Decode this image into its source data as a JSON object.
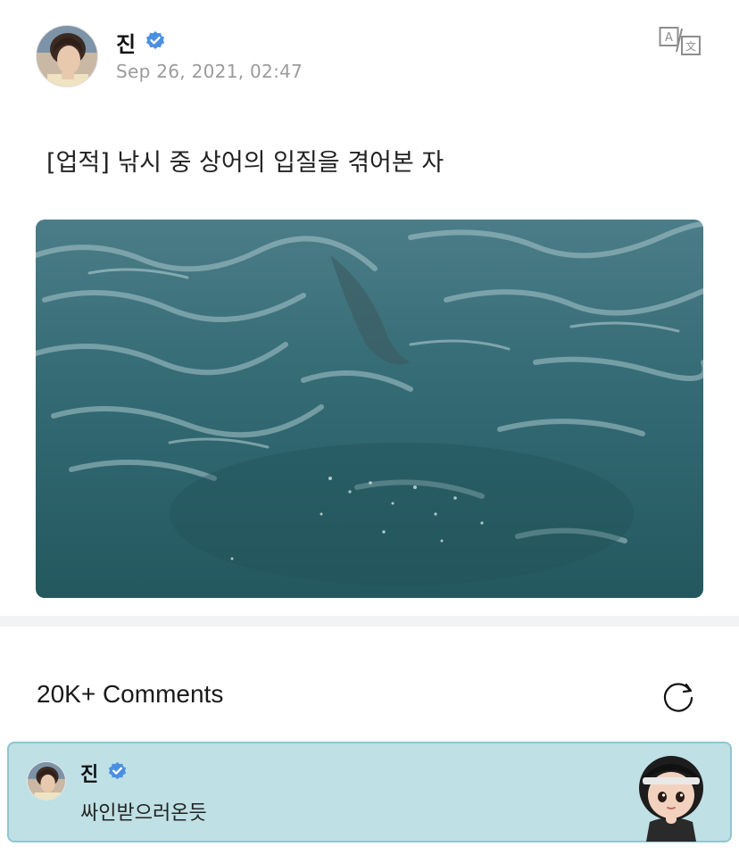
{
  "post": {
    "author": "진",
    "date": "Sep 26, 2021, 02:47",
    "text": "[업적] 낚시 중 상어의 입질을 겪어본 자",
    "translate_icon": "translate-icon"
  },
  "comments": {
    "title": "20K+ Comments",
    "refresh_icon": "refresh-icon",
    "pinned": {
      "author": "진",
      "text": "싸인받으러온듯"
    }
  },
  "colors": {
    "verified": "#4a90e2",
    "pinned_bg": "#bfe0e4",
    "water": "#2f6a74"
  }
}
